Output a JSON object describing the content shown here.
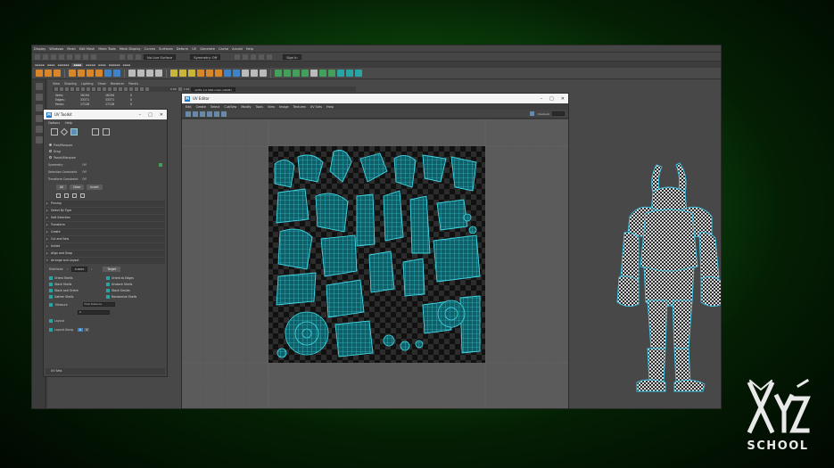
{
  "maya": {
    "main_menu": [
      "Display",
      "Windows",
      "Mesh",
      "Edit Mesh",
      "Mesh Tools",
      "Mesh Display",
      "Curves",
      "Surfaces",
      "Deform",
      "UV",
      "Generate",
      "Cache",
      "Arnold",
      "Help"
    ],
    "live_surface": "No Live Surface",
    "symmetry": "Symmetry: Off",
    "sign_in": "Sign In",
    "viewport_menu": [
      "View",
      "Shading",
      "Lighting",
      "Show",
      "Renderer",
      "Panels"
    ],
    "viewport_exposure": "0.00",
    "viewport_gamma": "1.00",
    "color_space": "ACES 1.0 SDR-video (sRGB)",
    "hud": {
      "rows": [
        {
          "label": "Verts:",
          "a": "16194",
          "b": "16194",
          "c": "0"
        },
        {
          "label": "Edges:",
          "a": "33371",
          "b": "33371",
          "c": "0"
        },
        {
          "label": "Faces:",
          "a": "17128",
          "b": "17128",
          "c": "0"
        }
      ]
    }
  },
  "uv_toolkit": {
    "title": "UV Toolkit",
    "menu": [
      "Options",
      "Help"
    ],
    "selection_modes": [
      "Pick/Marquee",
      "Drag",
      "Tweak/Marquee"
    ],
    "options": [
      {
        "label": "Symmetry",
        "value": "Off"
      },
      {
        "label": "Selection Constraint",
        "value": "Off"
      },
      {
        "label": "Transform Constraint",
        "value": "Off"
      }
    ],
    "buttons": [
      "All",
      "Clear",
      "Invert"
    ],
    "sections": [
      "Pinning",
      "Select By Type",
      "Soft Selection",
      "Transform",
      "Create",
      "Cut and Sew",
      "Unfold",
      "Align and Snap",
      "Arrange and Layout"
    ],
    "distribute_label": "Distribute",
    "distribute_value": "0.0000",
    "target_button": "Target",
    "arrange_tools": [
      "Orient Shells",
      "Orient to Edges",
      "Stack Shells",
      "Unstack Shells",
      "Stack and Orient",
      "Stack Similar",
      "Gather Shells",
      "Randomize Shells"
    ],
    "measure_label": "Measure",
    "measure_value": "Pixel Distance",
    "measure_number": "0",
    "layout_label": "Layout",
    "layout_along_label": "Layout Along",
    "layout_along_u": "U",
    "layout_along_v": "V",
    "uv_sets_label": "UV Sets"
  },
  "uv_editor": {
    "title": "UV Editor",
    "menu": [
      "Edit",
      "Create",
      "Select",
      "Cut/Sew",
      "Modify",
      "Tools",
      "View",
      "Image",
      "Textures",
      "UV Sets",
      "Help"
    ],
    "texture_option": "checkerb"
  },
  "watermark": {
    "brand_glyphs": "XYZ",
    "school": "SCHOOL"
  }
}
